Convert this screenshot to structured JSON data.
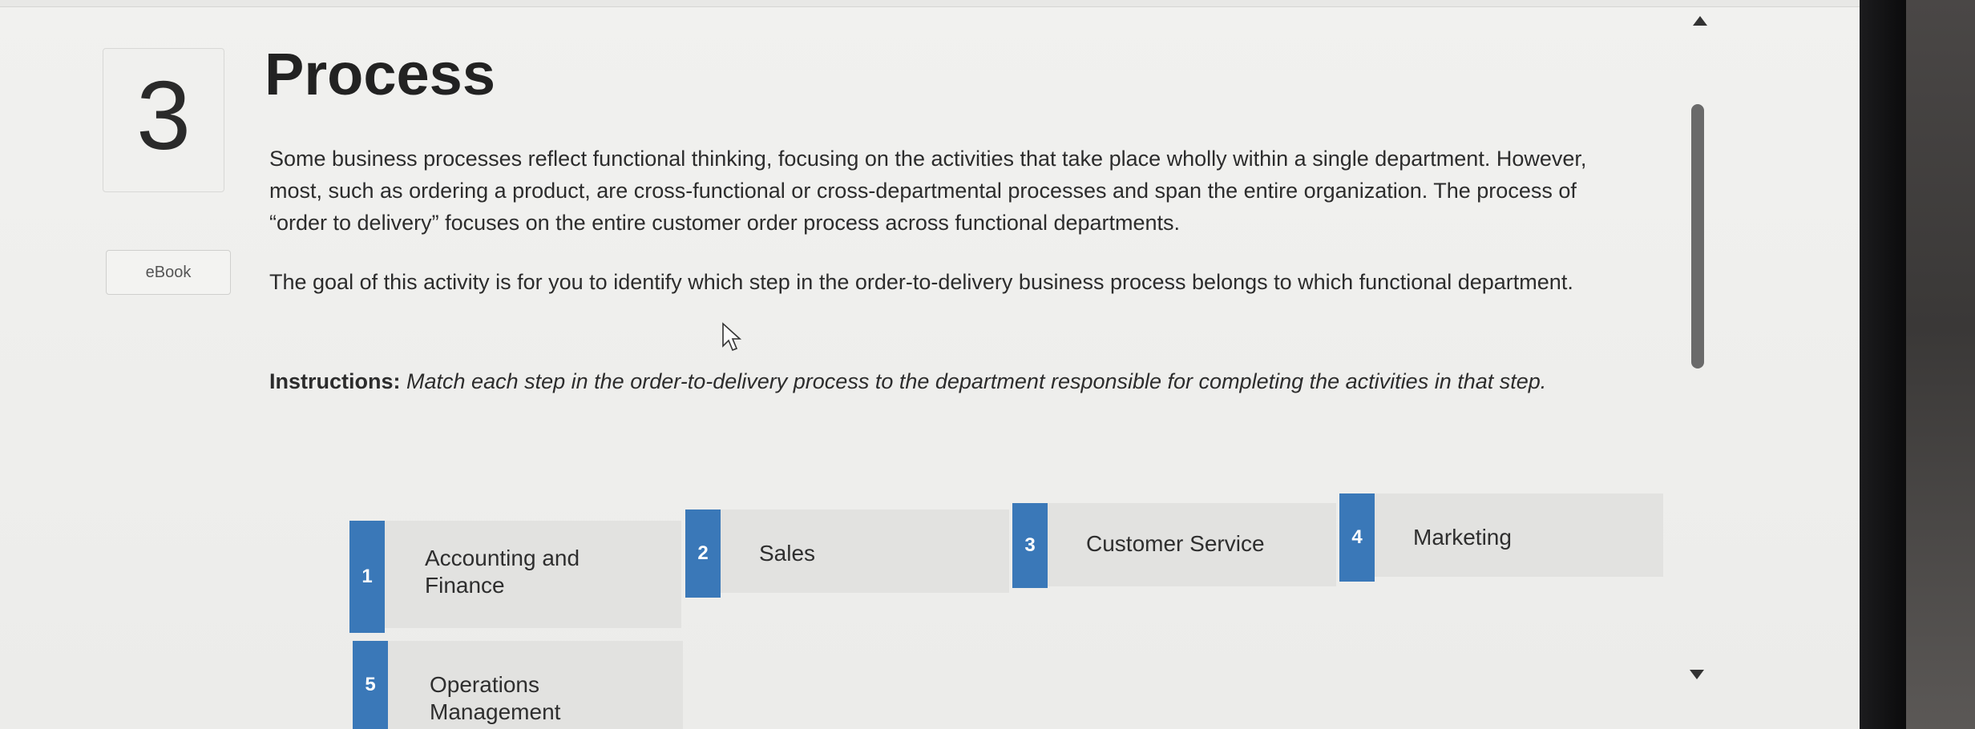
{
  "question": {
    "number": "3",
    "ebook_label": "eBook",
    "title": "Process"
  },
  "body": {
    "para1": "Some business processes reflect functional thinking, focusing on the activities that take place wholly within a single department. However, most, such as ordering a product, are cross-functional or cross-departmental processes and span the entire organization. The process of “order to delivery” focuses on the entire customer order process across functional departments.",
    "para2": "The goal of this activity is for you to identify which step in the order-to-delivery business process belongs to which functional department.",
    "instructions_label": "Instructions:",
    "instructions_text": "Match each step in the order-to-delivery process to the department responsible for completing the activities in that step."
  },
  "cards": [
    {
      "number": "1",
      "label": "Accounting and\nFinance"
    },
    {
      "number": "2",
      "label": "Sales"
    },
    {
      "number": "3",
      "label": "Customer Service"
    },
    {
      "number": "4",
      "label": "Marketing"
    },
    {
      "number": "5",
      "label": "Operations\nManagement"
    }
  ],
  "colors": {
    "tab_blue": "#3a78b8",
    "card_bg": "#e2e2e0",
    "page_bg": "#efefed"
  },
  "icons": {
    "scroll_up": "triangle-up-icon",
    "scroll_down": "triangle-down-icon",
    "cursor": "mouse-pointer-icon"
  }
}
